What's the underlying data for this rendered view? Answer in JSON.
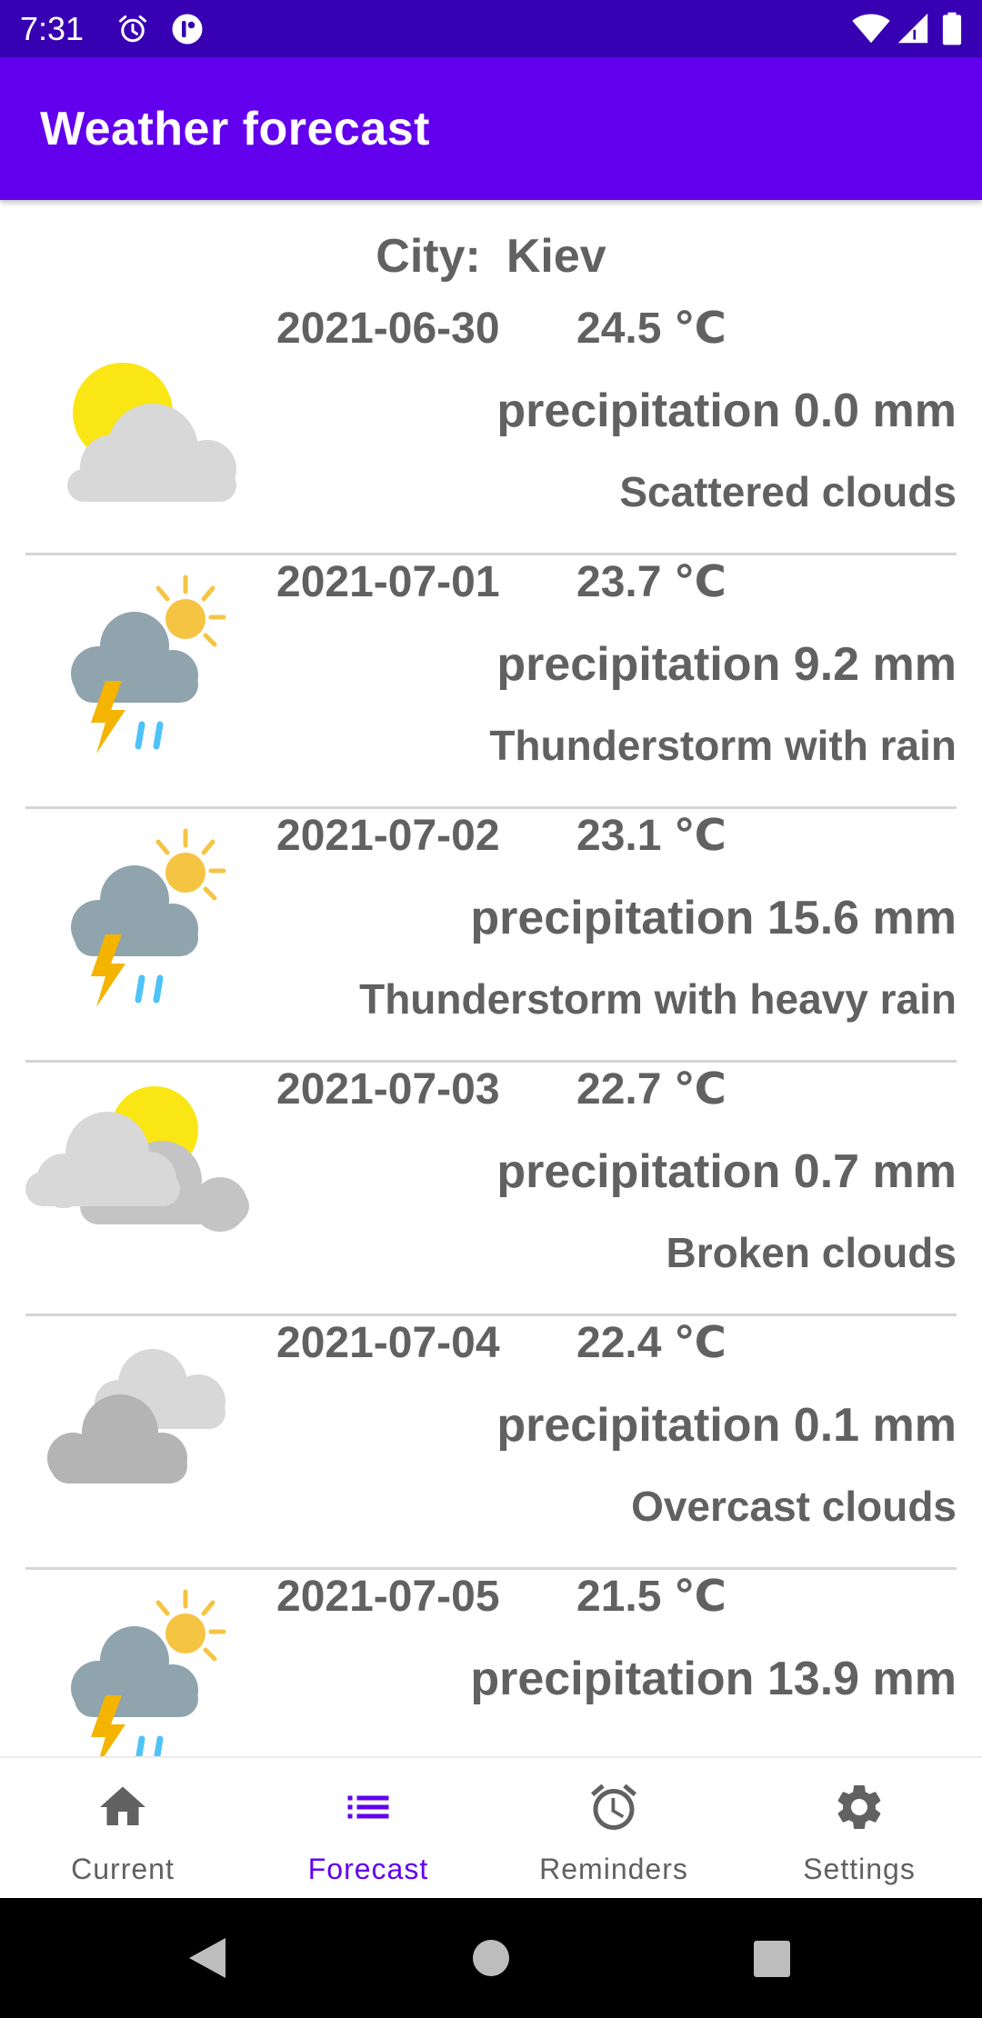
{
  "status_bar": {
    "time": "7:31",
    "icons": [
      "alarm-icon",
      "app-notification-icon",
      "wifi-icon",
      "signal-icon",
      "battery-icon"
    ]
  },
  "app_bar": {
    "title": "Weather forecast"
  },
  "city": {
    "label": "City:",
    "name": "Kiev"
  },
  "forecast": [
    {
      "date": "2021-06-30",
      "temp": "24.5 ℃",
      "precipitation": "precipitation 0.0 mm",
      "description": "Scattered clouds",
      "icon": "sun-cloud-icon"
    },
    {
      "date": "2021-07-01",
      "temp": "23.7 ℃",
      "precipitation": "precipitation 9.2 mm",
      "description": "Thunderstorm with rain",
      "icon": "thunderstorm-icon"
    },
    {
      "date": "2021-07-02",
      "temp": "23.1 ℃",
      "precipitation": "precipitation 15.6 mm",
      "description": "Thunderstorm with heavy rain",
      "icon": "thunderstorm-icon"
    },
    {
      "date": "2021-07-03",
      "temp": "22.7 ℃",
      "precipitation": "precipitation 0.7 mm",
      "description": "Broken clouds",
      "icon": "broken-clouds-icon"
    },
    {
      "date": "2021-07-04",
      "temp": "22.4 ℃",
      "precipitation": "precipitation 0.1 mm",
      "description": "Overcast clouds",
      "icon": "overcast-clouds-icon"
    },
    {
      "date": "2021-07-05",
      "temp": "21.5 ℃",
      "precipitation": "precipitation 13.9 mm",
      "description": "",
      "icon": "thunderstorm-icon"
    }
  ],
  "bottom_nav": {
    "items": [
      {
        "label": "Current",
        "icon": "home-icon"
      },
      {
        "label": "Forecast",
        "icon": "list-icon"
      },
      {
        "label": "Reminders",
        "icon": "alarm-clock-icon"
      },
      {
        "label": "Settings",
        "icon": "gear-icon"
      }
    ],
    "active": "Forecast"
  },
  "colors": {
    "status_bar": "#3700b3",
    "app_bar": "#6200ee",
    "accent": "#6200ee",
    "text": "#616161",
    "sun": "#f9e614",
    "cloud_light": "#d8d8d8",
    "cloud_dark": "#b8b8b8",
    "storm_cloud": "#90a4ae",
    "lightning": "#f4b400",
    "rain": "#4fc3f7"
  }
}
